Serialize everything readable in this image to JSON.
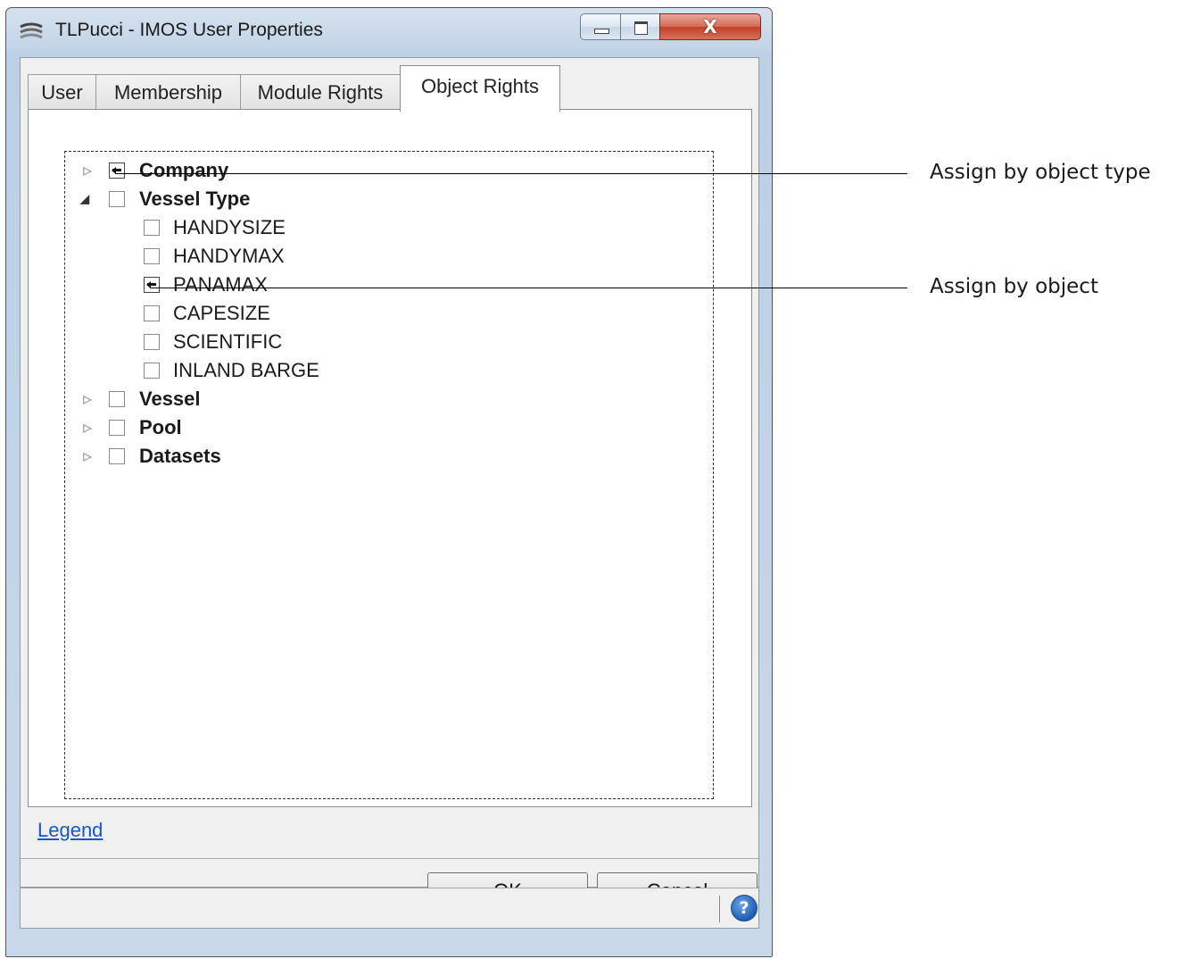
{
  "window": {
    "title": "TLPucci - IMOS User Properties",
    "close_glyph": "X"
  },
  "tabs": [
    {
      "label": "User"
    },
    {
      "label": "Membership"
    },
    {
      "label": "Module Rights"
    },
    {
      "label": "Object Rights",
      "active": true
    }
  ],
  "tree": {
    "nodes": [
      {
        "label": "Company",
        "bold": true,
        "expander": "collapsed",
        "state": "assigned-struck"
      },
      {
        "label": "Vessel Type",
        "bold": true,
        "expander": "expanded",
        "state": "unchecked"
      },
      {
        "label": "HANDYSIZE",
        "bold": false,
        "state": "unchecked"
      },
      {
        "label": "HANDYMAX",
        "bold": false,
        "state": "unchecked"
      },
      {
        "label": "PANAMAX",
        "bold": false,
        "state": "assigned-struck"
      },
      {
        "label": "CAPESIZE",
        "bold": false,
        "state": "unchecked"
      },
      {
        "label": "SCIENTIFIC",
        "bold": false,
        "state": "unchecked"
      },
      {
        "label": "INLAND BARGE",
        "bold": false,
        "state": "unchecked"
      },
      {
        "label": "Vessel",
        "bold": true,
        "expander": "collapsed",
        "state": "unchecked"
      },
      {
        "label": "Pool",
        "bold": true,
        "expander": "collapsed",
        "state": "unchecked"
      },
      {
        "label": "Datasets",
        "bold": true,
        "expander": "collapsed",
        "state": "unchecked"
      }
    ]
  },
  "legend_link": "Legend",
  "buttons": {
    "ok": "OK",
    "cancel": "Cancel"
  },
  "help_glyph": "?",
  "annotations": {
    "by_type": "Assign by object type",
    "by_object": "Assign by object"
  },
  "colors": {
    "link": "#1a55c8",
    "titlebar": "#c5d6e8",
    "close_button": "#c1412a"
  }
}
